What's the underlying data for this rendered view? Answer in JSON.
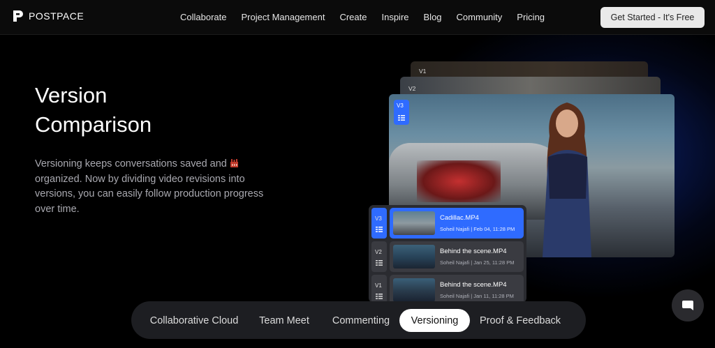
{
  "nav": {
    "brand": "POSTPACE",
    "links": [
      "Collaborate",
      "Project Management",
      "Create",
      "Inspire",
      "Blog",
      "Community",
      "Pricing"
    ],
    "cta": "Get Started - It's Free"
  },
  "hero": {
    "title_line1": "Version",
    "title_line2": "Comparison",
    "description_before_emoji": "Versioning keeps conversations saved and ",
    "description_after_emoji": " organized. Now by dividing video revisions into versions, you can easily follow production progress over time."
  },
  "frames": {
    "v1_label": "V1",
    "v2_label": "V2",
    "v3_label": "V3"
  },
  "versions": [
    {
      "tag": "V3",
      "name": "Cadillac.MP4",
      "meta": "Soheil Najafi | Feb 04, 11:28 PM",
      "selected": true
    },
    {
      "tag": "V2",
      "name": "Behind the scene.MP4",
      "meta": "Soheil Najafi | Jan 25, 11:28 PM",
      "selected": false
    },
    {
      "tag": "V1",
      "name": "Behind the scene.MP4",
      "meta": "Soheil Najafi | Jan 11, 11:28 PM",
      "selected": false
    }
  ],
  "tabs": [
    "Collaborative Cloud",
    "Team Meet",
    "Commenting",
    "Versioning",
    "Proof & Feedback"
  ],
  "active_tab": "Versioning",
  "colors": {
    "accent": "#2f6bff",
    "background": "#000000",
    "cta_bg": "#e9e9e9"
  },
  "icons": [
    "logo-icon",
    "emoji-icon",
    "list-icon",
    "chat-icon"
  ]
}
